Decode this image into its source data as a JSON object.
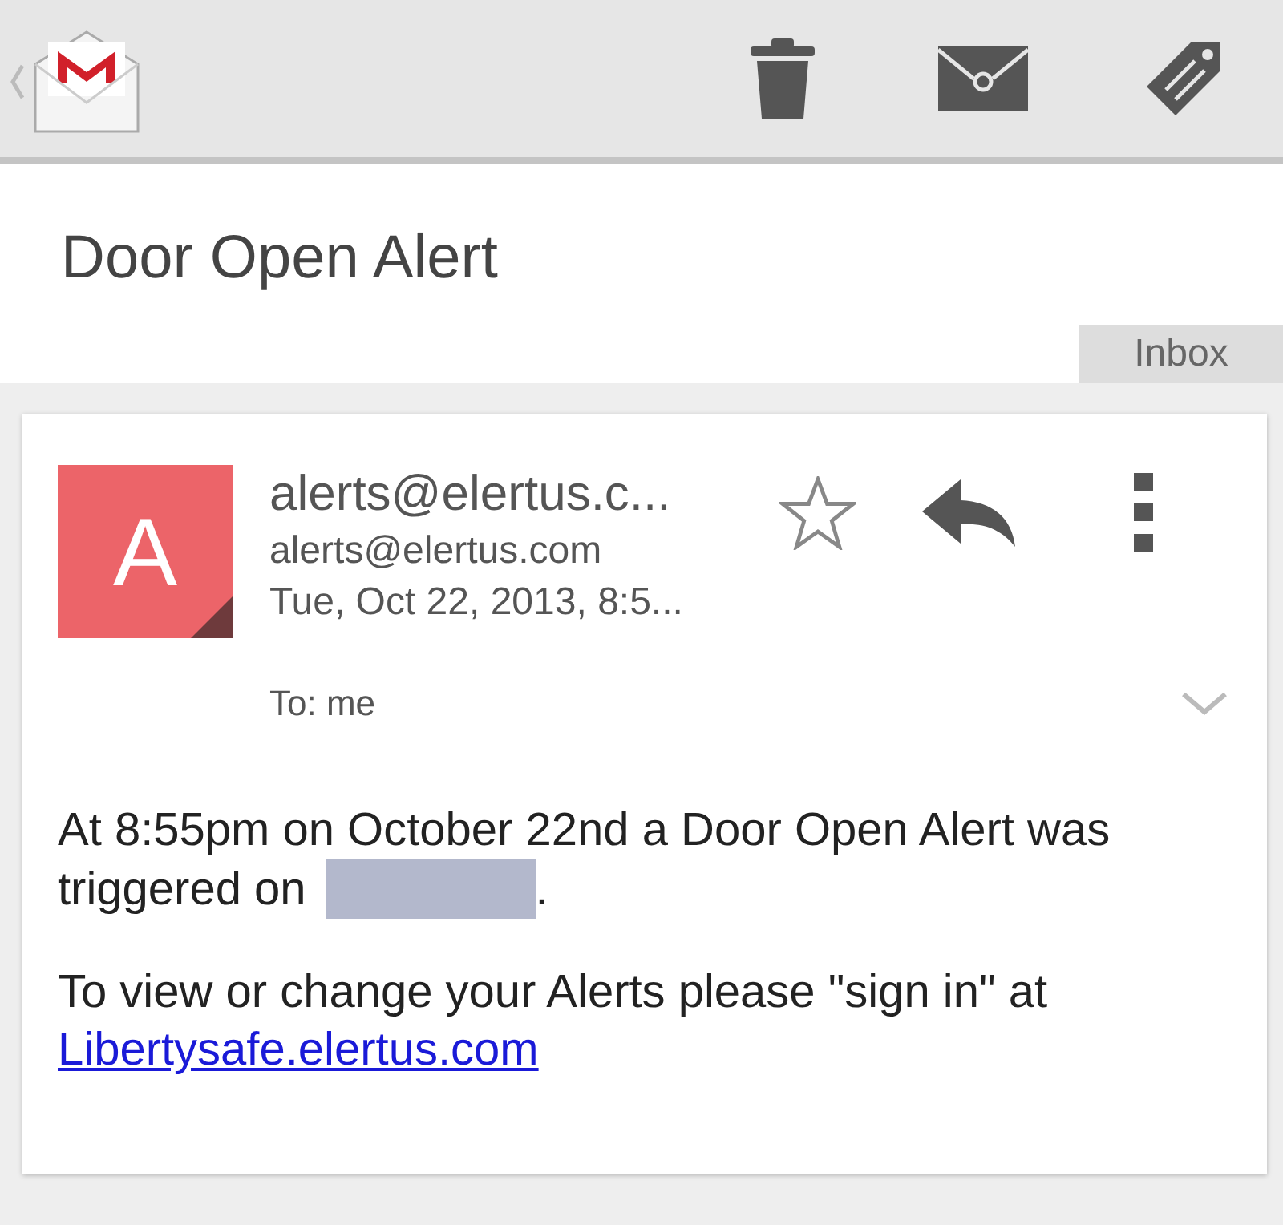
{
  "action_bar": {
    "actions": [
      {
        "kind": "delete"
      },
      {
        "kind": "archive"
      },
      {
        "kind": "label"
      }
    ]
  },
  "subject": "Door Open Alert",
  "folder_tag": "Inbox",
  "message": {
    "avatar_letter": "A",
    "sender_name": "alerts@elertus.c...",
    "sender_email": "alerts@elertus.com",
    "date": "Tue, Oct 22, 2013, 8:5...",
    "starred": false,
    "recipients": "To: me",
    "body": [
      {
        "kind": "redacted_line",
        "text": "At 8:55pm on October 22nd a Door Open Alert was",
        "continued": "triggered on",
        "after": "."
      },
      {
        "kind": "link_line",
        "text": "To view or change your Alerts please \"sign in\" at",
        "link": "Libertysafe.elertus.com"
      }
    ]
  }
}
